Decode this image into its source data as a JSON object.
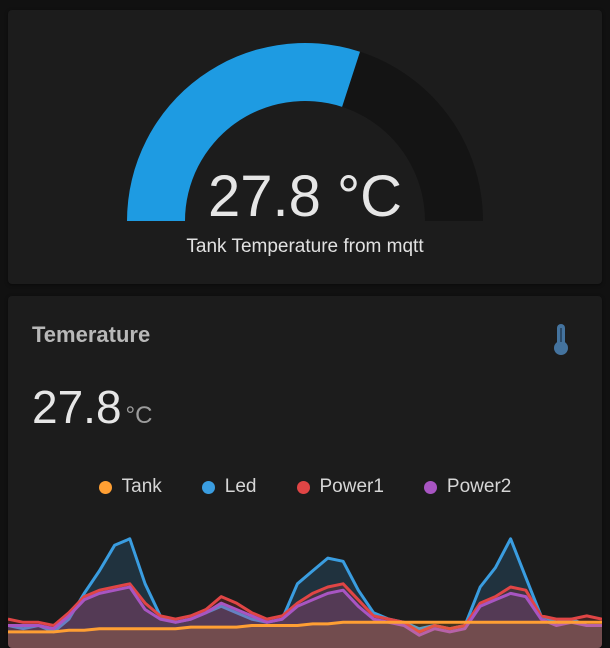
{
  "gauge": {
    "value": "27.8 °C",
    "name": "Tank Temperature from mqtt",
    "fraction": 0.6,
    "fill_color": "#1e9be2",
    "track_color": "#141414"
  },
  "sensor": {
    "title": "Temerature",
    "value": "27.8",
    "unit": "°C",
    "icon": "thermometer-icon",
    "icon_color": "#44739e"
  },
  "chart_data": {
    "type": "area",
    "title": "",
    "legend_position": "top",
    "series": [
      {
        "name": "Tank",
        "color": "#ff9f33",
        "values": [
          23,
          23,
          23,
          23,
          23.5,
          23.5,
          24,
          24,
          24,
          24,
          24,
          24,
          24.5,
          24.5,
          24.5,
          24.5,
          25,
          25,
          25,
          25,
          25.5,
          25.5,
          26,
          26,
          26,
          26,
          26,
          26,
          26,
          26,
          26,
          26,
          26,
          26,
          26,
          26,
          26,
          26,
          26,
          26
        ]
      },
      {
        "name": "Led",
        "color": "#3a9de0",
        "values": [
          25,
          24,
          25,
          23,
          27,
          35,
          42,
          50,
          52,
          38,
          28,
          26,
          27,
          29,
          31,
          29,
          27,
          26,
          27,
          38,
          42,
          46,
          45,
          36,
          29,
          27,
          26,
          24,
          25,
          24,
          25,
          37,
          43,
          52,
          40,
          28,
          26,
          27,
          25,
          25
        ]
      },
      {
        "name": "Power1",
        "color": "#e04545",
        "values": [
          27,
          26,
          26,
          25,
          29,
          34,
          36,
          37,
          38,
          32,
          28,
          27,
          28,
          30,
          34,
          32,
          29,
          27,
          28,
          32,
          35,
          37,
          38,
          33,
          28,
          27,
          26,
          23,
          25,
          24,
          25,
          32,
          34,
          37,
          36,
          28,
          27,
          27,
          28,
          27
        ]
      },
      {
        "name": "Power2",
        "color": "#a855c2",
        "values": [
          25,
          25,
          25,
          24,
          28,
          33,
          35,
          36,
          37,
          30,
          27,
          26,
          27,
          29,
          32,
          30,
          28,
          26,
          27,
          31,
          33,
          35,
          36,
          31,
          27,
          26,
          25,
          22,
          24,
          23,
          24,
          31,
          33,
          35,
          34,
          27,
          25,
          26,
          25,
          25
        ]
      }
    ]
  }
}
